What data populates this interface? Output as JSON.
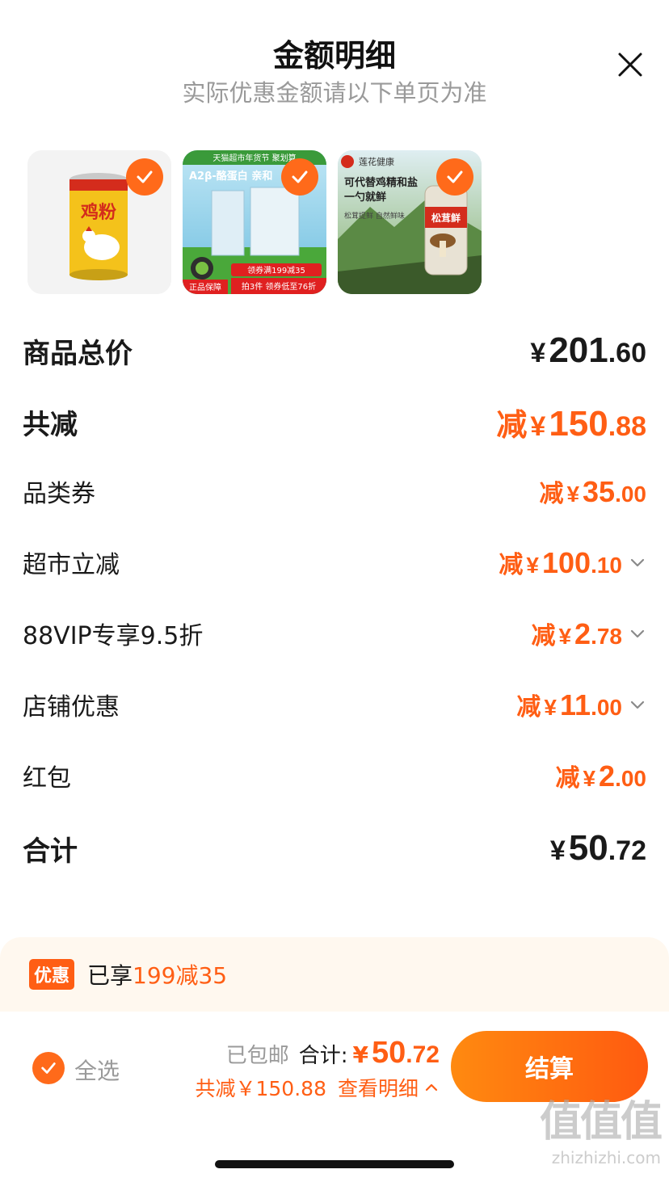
{
  "header": {
    "title": "金额明细",
    "subtitle": "实际优惠金额请以下单页为准"
  },
  "products": [
    {
      "name": "鸡粉",
      "badge": "",
      "lines": []
    },
    {
      "name": "A2β-酪蛋白 亲和",
      "badge": "正品保障",
      "lines": [
        "天猫超市年货节 聚划算",
        "领券满199减35",
        "拍3件 领券低至76折"
      ]
    },
    {
      "name": "松茸鲜",
      "badge": "莲花健康",
      "lines": [
        "可代替鸡精和盐",
        "一勺就鲜",
        "松茸提鲜 自然鲜味"
      ]
    }
  ],
  "breakdown": {
    "total": {
      "label": "商品总价",
      "symbol": "¥",
      "int": "201",
      "dec": ".60"
    },
    "reduced": {
      "label": "共减",
      "prefix": "减",
      "symbol": "¥",
      "int": "150",
      "dec": ".88"
    },
    "items": [
      {
        "label": "品类券",
        "prefix": "减",
        "symbol": "¥",
        "int": "35",
        "dec": ".00",
        "expandable": false
      },
      {
        "label": "超市立减",
        "prefix": "减",
        "symbol": "¥",
        "int": "100",
        "dec": ".10",
        "expandable": true
      },
      {
        "label": "88VIP专享9.5折",
        "prefix": "减",
        "symbol": "¥",
        "int": "2",
        "dec": ".78",
        "expandable": true
      },
      {
        "label": "店铺优惠",
        "prefix": "减",
        "symbol": "¥",
        "int": "11",
        "dec": ".00",
        "expandable": true
      },
      {
        "label": "红包",
        "prefix": "减",
        "symbol": "¥",
        "int": "2",
        "dec": ".00",
        "expandable": false
      }
    ],
    "sum": {
      "label": "合计",
      "symbol": "¥",
      "int": "50",
      "dec": ".72"
    }
  },
  "promo": {
    "badge": "优惠",
    "text_prefix": "已享",
    "text_highlight": "199减35"
  },
  "footer": {
    "select_all": "全选",
    "shipping": "已包邮",
    "total_label": "合计:",
    "symbol": "¥",
    "total_int": "50",
    "total_dec": ".72",
    "reduced_text": "共减￥150.88",
    "detail_link": "查看明细",
    "checkout": "结算"
  },
  "watermark": {
    "big": "值值值",
    "small": "zhizhizhi.com"
  },
  "colors": {
    "accent": "#ff5e14",
    "text": "#1a1a1a",
    "muted": "#9a9a9a"
  }
}
